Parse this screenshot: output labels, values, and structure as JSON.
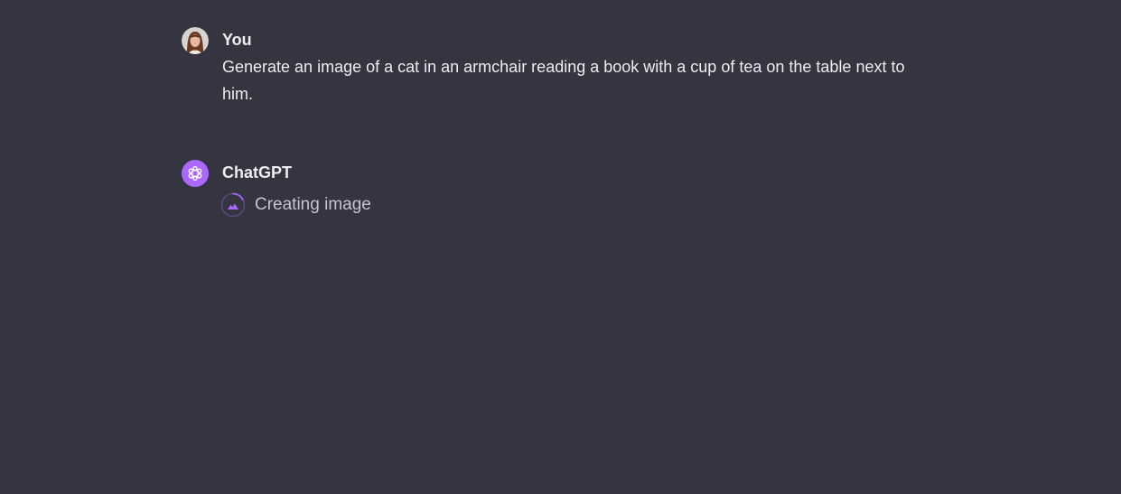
{
  "user_message": {
    "author": "You",
    "text": "Generate an image of a cat in an armchair reading a book with a cup of tea on the table next to him."
  },
  "assistant_message": {
    "author": "ChatGPT",
    "status": "Creating image"
  },
  "colors": {
    "background": "#343541",
    "text": "#ececf1",
    "accent": "#ab68ff",
    "muted_text": "#c5c5d2"
  },
  "icons": {
    "user_avatar": "user-photo-avatar",
    "assistant_avatar": "openai-logo-icon",
    "status": "image-generating-spinner-icon"
  }
}
